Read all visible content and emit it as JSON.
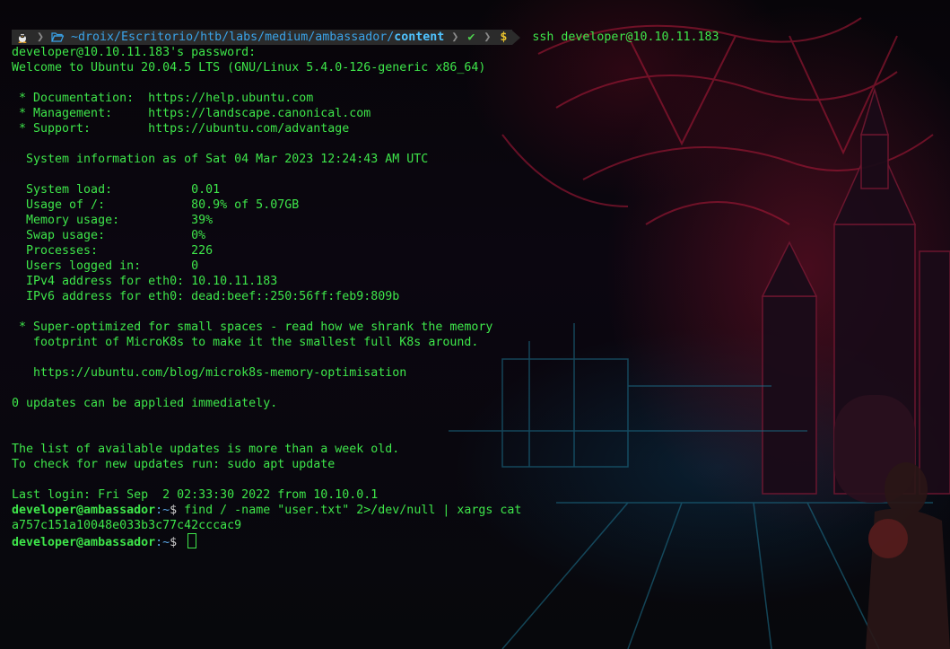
{
  "prompt": {
    "os_icon": "linux-tux-icon",
    "folder_icon": "folder-open-icon",
    "path_prefix": "~droix/Escritorio/htb/labs/medium/ambassador/",
    "path_current": "content",
    "status_check": "✔",
    "dollar": "$",
    "command": "ssh developer@10.10.11.183"
  },
  "output": [
    "developer@10.10.11.183's password:",
    "Welcome to Ubuntu 20.04.5 LTS (GNU/Linux 5.4.0-126-generic x86_64)",
    "",
    " * Documentation:  https://help.ubuntu.com",
    " * Management:     https://landscape.canonical.com",
    " * Support:        https://ubuntu.com/advantage",
    "",
    "  System information as of Sat 04 Mar 2023 12:24:43 AM UTC",
    "",
    "  System load:           0.01",
    "  Usage of /:            80.9% of 5.07GB",
    "  Memory usage:          39%",
    "  Swap usage:            0%",
    "  Processes:             226",
    "  Users logged in:       0",
    "  IPv4 address for eth0: 10.10.11.183",
    "  IPv6 address for eth0: dead:beef::250:56ff:feb9:809b",
    "",
    " * Super-optimized for small spaces - read how we shrank the memory",
    "   footprint of MicroK8s to make it the smallest full K8s around.",
    "",
    "   https://ubuntu.com/blog/microk8s-memory-optimisation",
    "",
    "0 updates can be applied immediately.",
    "",
    "",
    "The list of available updates is more than a week old.",
    "To check for new updates run: sudo apt update",
    "",
    "Last login: Fri Sep  2 02:33:30 2022 from 10.10.0.1"
  ],
  "shell": {
    "user_host": "developer@ambassador",
    "path": ":~",
    "dollar": "$ ",
    "command": "find / -name \"user.txt\" 2>/dev/null | xargs cat",
    "result": "a757c151a10048e033b3c77c42cccac9"
  },
  "colors": {
    "text": "#3ee64a",
    "path": "#3aa3e8",
    "dollar": "#e8c22c"
  }
}
